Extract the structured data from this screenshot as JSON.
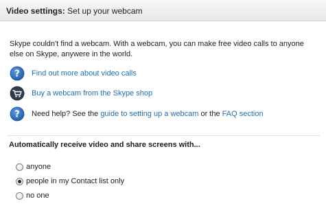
{
  "header": {
    "title": "Video settings:",
    "subtitle": "Set up your webcam"
  },
  "intro": {
    "text": "Skype couldn't find a webcam. With a webcam, you can make free video calls to anyone else on Skype, anywere in the world."
  },
  "links": {
    "video_calls": {
      "icon": "question-icon",
      "label": "Find out more about video calls"
    },
    "buy_webcam": {
      "icon": "shopping-cart-icon",
      "label": "Buy a webcam from the Skype shop"
    },
    "help": {
      "icon": "question-icon",
      "prefix": "Need help? See the ",
      "guide_link": "guide to setting up a webcam",
      "middle": " or the ",
      "faq_link": "FAQ section"
    }
  },
  "auto_receive": {
    "title": "Automatically receive video and share screens with...",
    "options": [
      {
        "label": "anyone",
        "selected": false
      },
      {
        "label": "people in my Contact list only",
        "selected": true
      },
      {
        "label": "no one",
        "selected": false
      }
    ]
  },
  "colors": {
    "link": "#1b6fb5",
    "icon_blue": "#2a6fc2",
    "icon_dark": "#2f3a4a"
  }
}
